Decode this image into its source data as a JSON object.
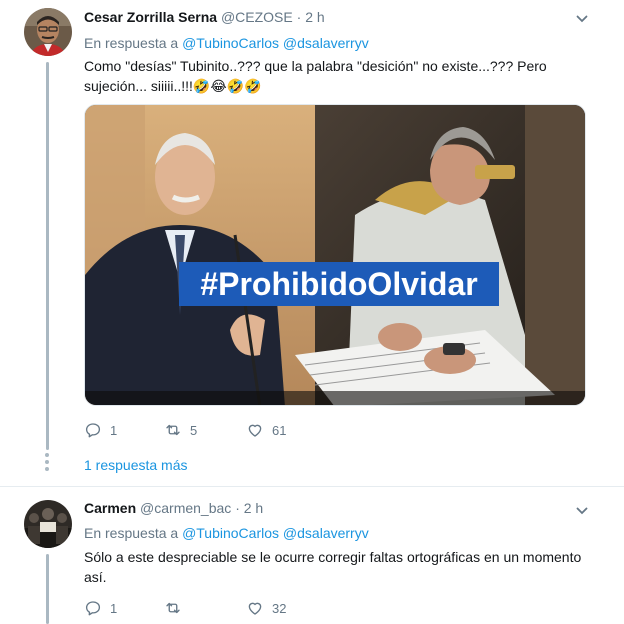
{
  "tweets": [
    {
      "author_name": "Cesar Zorrilla Serna",
      "author_handle": "@CEZOSE",
      "separator": "·",
      "time": "2 h",
      "replying_prefix": "En respuesta a",
      "replying_to": [
        "@TubinoCarlos",
        "@dsalaverryv"
      ],
      "text_line1": "Como \"desías\" Tubinito..???  que la palabra \"desición\" no existe...???   Pero",
      "text_line2": "sujeción...  siiiii..!!!🤣😂🤣🤣",
      "media_caption": "#ProhibidoOlvidar",
      "reply_count": "1",
      "retweet_count": "5",
      "like_count": "61",
      "more_replies": "1 respuesta más"
    },
    {
      "author_name": "Carmen",
      "author_handle": "@carmen_bac",
      "separator": "·",
      "time": "2 h",
      "replying_prefix": "En respuesta a",
      "replying_to": [
        "@TubinoCarlos",
        "@dsalaverryv"
      ],
      "text_line1": "Sólo a este despreciable se le ocurre corregir faltas ortográficas en un momento",
      "text_line2": "así.",
      "reply_count": "1",
      "retweet_count": "",
      "like_count": "32"
    }
  ],
  "icons": {
    "reply": "reply-icon",
    "retweet": "retweet-icon",
    "like": "heart-icon",
    "caret": "chevron-down-icon"
  },
  "colors": {
    "link": "#1b95e0",
    "secondary_text": "#657786",
    "thread_line": "#aab8c2",
    "caption_bg": "#1d5bb8"
  }
}
